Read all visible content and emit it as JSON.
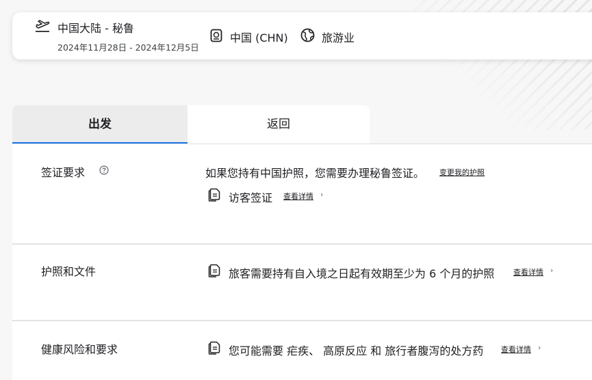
{
  "trip": {
    "route": "中国大陆 - 秘鲁",
    "dates": "2024年11月28日 - 2024年12月5日",
    "nationality": "中国 (CHN)",
    "purpose": "旅游业"
  },
  "tabs": [
    {
      "label": "出发",
      "active": true
    },
    {
      "label": "返回",
      "active": false
    }
  ],
  "sections": {
    "visa": {
      "label": "签证要求",
      "statement": "如果您持有中国护照，您需要办理秘鲁签证。",
      "change_link": "变更我的护照",
      "item": "访客签证",
      "details_link": "查看详情"
    },
    "passport": {
      "label": "护照和文件",
      "item": "旅客需要持有自入境之日起有效期至少为 6 个月的护照",
      "details_link": "查看详情"
    },
    "health": {
      "label": "健康风险和要求",
      "item": "您可能需要 疟疾、 高原反应 和 旅行者腹泻的处方药",
      "details_link": "查看详情"
    }
  },
  "icons": [
    "plane-takeoff-icon",
    "passport-icon",
    "globe-icon",
    "help-circle-icon",
    "document-icon",
    "chevron-right-icon"
  ],
  "colors": {
    "accent": "#1a73e8",
    "text": "#202124",
    "background": "#f7f7f7"
  }
}
